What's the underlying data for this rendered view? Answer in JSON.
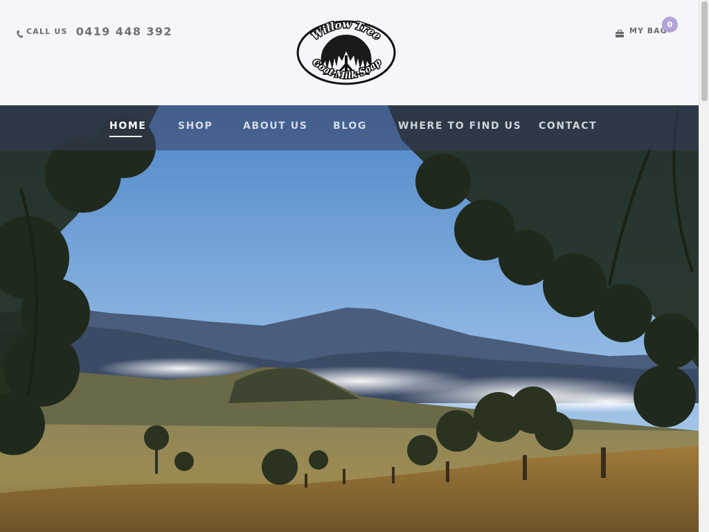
{
  "header": {
    "call_label": "CALL US",
    "phone_number": "0419 448 392",
    "logo": {
      "top_text": "Willow Tree",
      "bottom_text": "Goat Milk Soap"
    },
    "bag_label": "MY BAG",
    "bag_count": "0"
  },
  "nav": {
    "items": [
      {
        "label": "HOME",
        "active": true
      },
      {
        "label": "SHOP",
        "active": false
      },
      {
        "label": "ABOUT US",
        "active": false
      },
      {
        "label": "BLOG",
        "active": false
      },
      {
        "label": "WHERE TO FIND US",
        "active": false
      },
      {
        "label": "CONTACT",
        "active": false
      }
    ]
  },
  "colors": {
    "header_bg": "#f5f6fa",
    "badge": "#b3a4d8",
    "nav_overlay": "#373e5c",
    "sky": "#6f9fd6",
    "mountains": "#3d4f6c"
  },
  "icons": {
    "phone": "phone-icon",
    "bag": "briefcase-icon"
  }
}
